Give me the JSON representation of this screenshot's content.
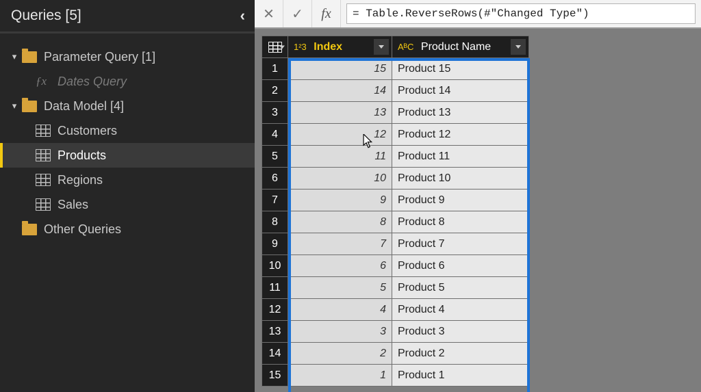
{
  "sidebar": {
    "title": "Queries [5]",
    "groups": [
      {
        "label": "Parameter Query [1]",
        "type": "folder",
        "expanded": true
      },
      {
        "label": "Dates Query",
        "type": "fx",
        "dim": true
      },
      {
        "label": "Data Model [4]",
        "type": "folder",
        "expanded": true
      },
      {
        "label": "Customers",
        "type": "table"
      },
      {
        "label": "Products",
        "type": "table",
        "selected": true
      },
      {
        "label": "Regions",
        "type": "table"
      },
      {
        "label": "Sales",
        "type": "table"
      },
      {
        "label": "Other Queries",
        "type": "folder",
        "expanded": false,
        "toplevel": true
      }
    ]
  },
  "formula_bar": {
    "cancel": "✕",
    "confirm": "✓",
    "fx": "fx",
    "value": "= Table.ReverseRows(#\"Changed Type\")"
  },
  "columns": {
    "index": {
      "type_icon": "1²3",
      "label": "Index"
    },
    "name": {
      "type_icon": "AᴮC",
      "label": "Product Name"
    }
  },
  "rows": [
    {
      "n": "1",
      "index": "15",
      "name": "Product 15"
    },
    {
      "n": "2",
      "index": "14",
      "name": "Product 14"
    },
    {
      "n": "3",
      "index": "13",
      "name": "Product 13"
    },
    {
      "n": "4",
      "index": "12",
      "name": "Product 12"
    },
    {
      "n": "5",
      "index": "11",
      "name": "Product 11"
    },
    {
      "n": "6",
      "index": "10",
      "name": "Product 10"
    },
    {
      "n": "7",
      "index": "9",
      "name": "Product 9"
    },
    {
      "n": "8",
      "index": "8",
      "name": "Product 8"
    },
    {
      "n": "9",
      "index": "7",
      "name": "Product 7"
    },
    {
      "n": "10",
      "index": "6",
      "name": "Product 6"
    },
    {
      "n": "11",
      "index": "5",
      "name": "Product 5"
    },
    {
      "n": "12",
      "index": "4",
      "name": "Product 4"
    },
    {
      "n": "13",
      "index": "3",
      "name": "Product 3"
    },
    {
      "n": "14",
      "index": "2",
      "name": "Product 2"
    },
    {
      "n": "15",
      "index": "1",
      "name": "Product 1"
    }
  ]
}
